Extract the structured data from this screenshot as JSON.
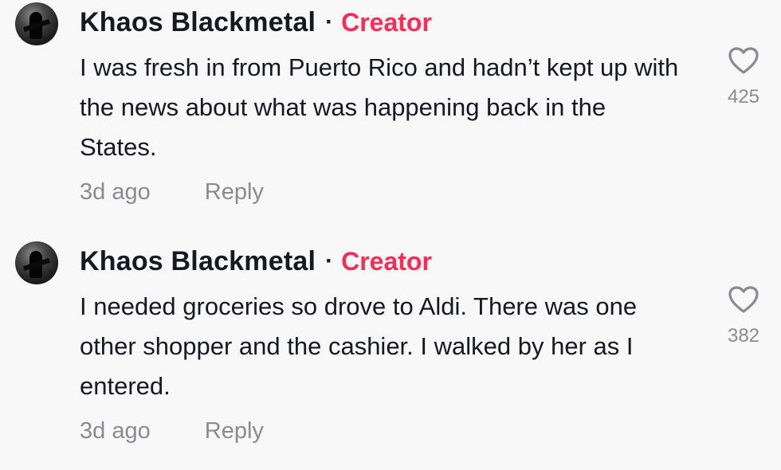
{
  "comments": [
    {
      "username": "Khaos Blackmetal",
      "separator": "·",
      "badge": "Creator",
      "text": "I was fresh in from Puerto Rico and hadn’t kept up with the news about what was happening back in the States.",
      "time": "3d ago",
      "reply_label": "Reply",
      "like_count": "425",
      "like_icon": "heart-outline-icon"
    },
    {
      "username": "Khaos Blackmetal",
      "separator": "·",
      "badge": "Creator",
      "text": "I needed groceries so drove to Aldi. There was one other shopper and the cashier. I walked by her as I entered.",
      "time": "3d ago",
      "reply_label": "Reply",
      "like_count": "382",
      "like_icon": "heart-outline-icon"
    }
  ],
  "colors": {
    "badge": "#fe2c55",
    "text": "#161823",
    "meta": "#8a8b91",
    "background": "#f8f8f8"
  }
}
